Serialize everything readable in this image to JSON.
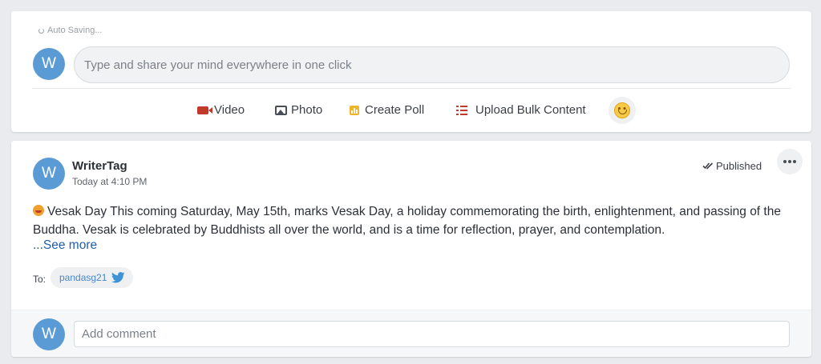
{
  "composer": {
    "autosave_text": "Auto Saving...",
    "avatar_initial": "W",
    "placeholder": "Type and share your mind everywhere in one click",
    "actions": [
      {
        "label": "Video",
        "icon": "video-icon"
      },
      {
        "label": "Photo",
        "icon": "photo-icon"
      },
      {
        "label": "Create Poll",
        "icon": "poll-icon"
      },
      {
        "label": "Upload Bulk Content",
        "icon": "list-icon"
      }
    ],
    "emoji_icon": "smiley-icon"
  },
  "post": {
    "avatar_initial": "W",
    "author": "WriterTag",
    "timestamp": "Today at 4:10 PM",
    "status": "Published",
    "body": "Vesak Day This coming Saturday, May 15th, marks Vesak Day, a holiday commemorating the birth, enlightenment, and passing of the Buddha. Vesak is celebrated by Buddhists all over the world, and is a time for reflection, prayer, and contemplation.",
    "see_more": "...See more",
    "to_label": "To:",
    "recipient": {
      "handle": "pandasg21",
      "network_icon": "twitter-icon"
    }
  },
  "comment": {
    "avatar_initial": "W",
    "placeholder": "Add comment"
  },
  "colors": {
    "avatar": "#5b9bd5",
    "link": "#1f5fae",
    "video": "#c0392b",
    "poll": "#f0b429",
    "twitter": "#3d93d6"
  }
}
